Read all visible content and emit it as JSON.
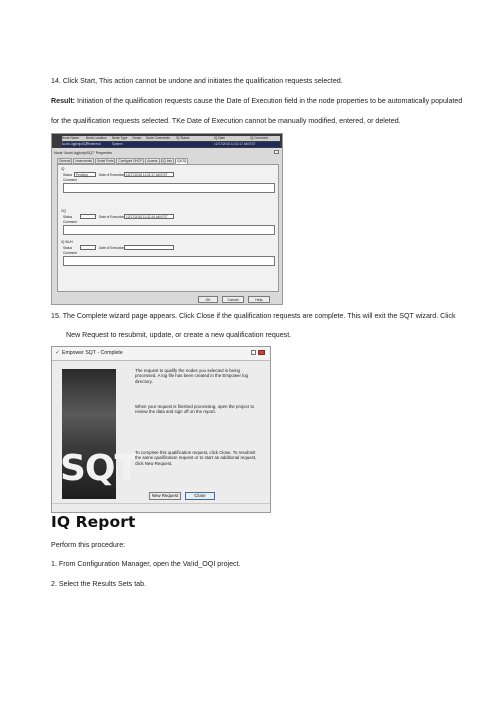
{
  "steps": {
    "step14": "14.  Click Start, This action cannot be undone and initiates the qualification requests selected.",
    "result_label": "Result:",
    "result_text": " Initiation of the qualification requests cause the Date of Execution field in the node properties to be automatically populated",
    "result_cont": "for the qualification requests selected. TKe Date of Execution cannot be manually modified, entered, or deleted.",
    "step15_a": "15.  The Complete wizard page appears. Click Close if the qualification requests are complete. This will exit the SQT wizard. Click",
    "step15_b": "New Request to resubmit, update, or create a new qualification request."
  },
  "props_screenshot": {
    "grid_headers": [
      "Node Name",
      "Node Location",
      "Node Type",
      "Owner",
      "Node Comments",
      "IQ Status",
      "IQ Date",
      "IQ Comment"
    ],
    "grid_row_node": "AcchI-dgjkmjoSQT",
    "grid_row_location": "Frederend",
    "grid_row_type": "System",
    "grid_row_date": "12/17/2015 11:02:17 AM EST",
    "window_title": "Node 'Acchi-dgjkmjoSQT' Properties",
    "tabs": [
      "General",
      "Instruments",
      "Serial Ports",
      "Configure DHCP",
      "Access",
      "IQ Info",
      "IQ/OQ"
    ],
    "iq_label": "IQ",
    "oq_label": "OQ",
    "iq_wuh_label": "IQ WUH",
    "status_label": "Status",
    "comment_label": "Comment",
    "date_label": "Date of Execution",
    "iq_status_value": "Pending",
    "iq_date_value": "12/17/2015 11:02:17 AM EST",
    "oq_date_value": "12/17/2015 11:32:34 AM EST",
    "ok": "OK",
    "cancel": "Cancel",
    "help": "Help"
  },
  "wizard_screenshot": {
    "title": "Empower SQT - Complete",
    "logo_text": "SQT",
    "msg1": "The request to qualify the nodes you selected is being processed.  A log file has been created in the Empower log directory.",
    "msg2": "When your request is finished processing, open the project to review the data and sign off on the report.",
    "msg3": "To complete this qualification request, click Close.  To resubmit the same qualification request or to start an additional request, click New Request.",
    "new_request": "New Request",
    "close": "Close"
  },
  "iq_report": {
    "heading": "IQ Report",
    "intro": "Perform this procedure:",
    "step1": "1.    From Configuration Manager, open the Va!id_OQI project.",
    "step2": "2.    Select the Results Sets tab."
  }
}
